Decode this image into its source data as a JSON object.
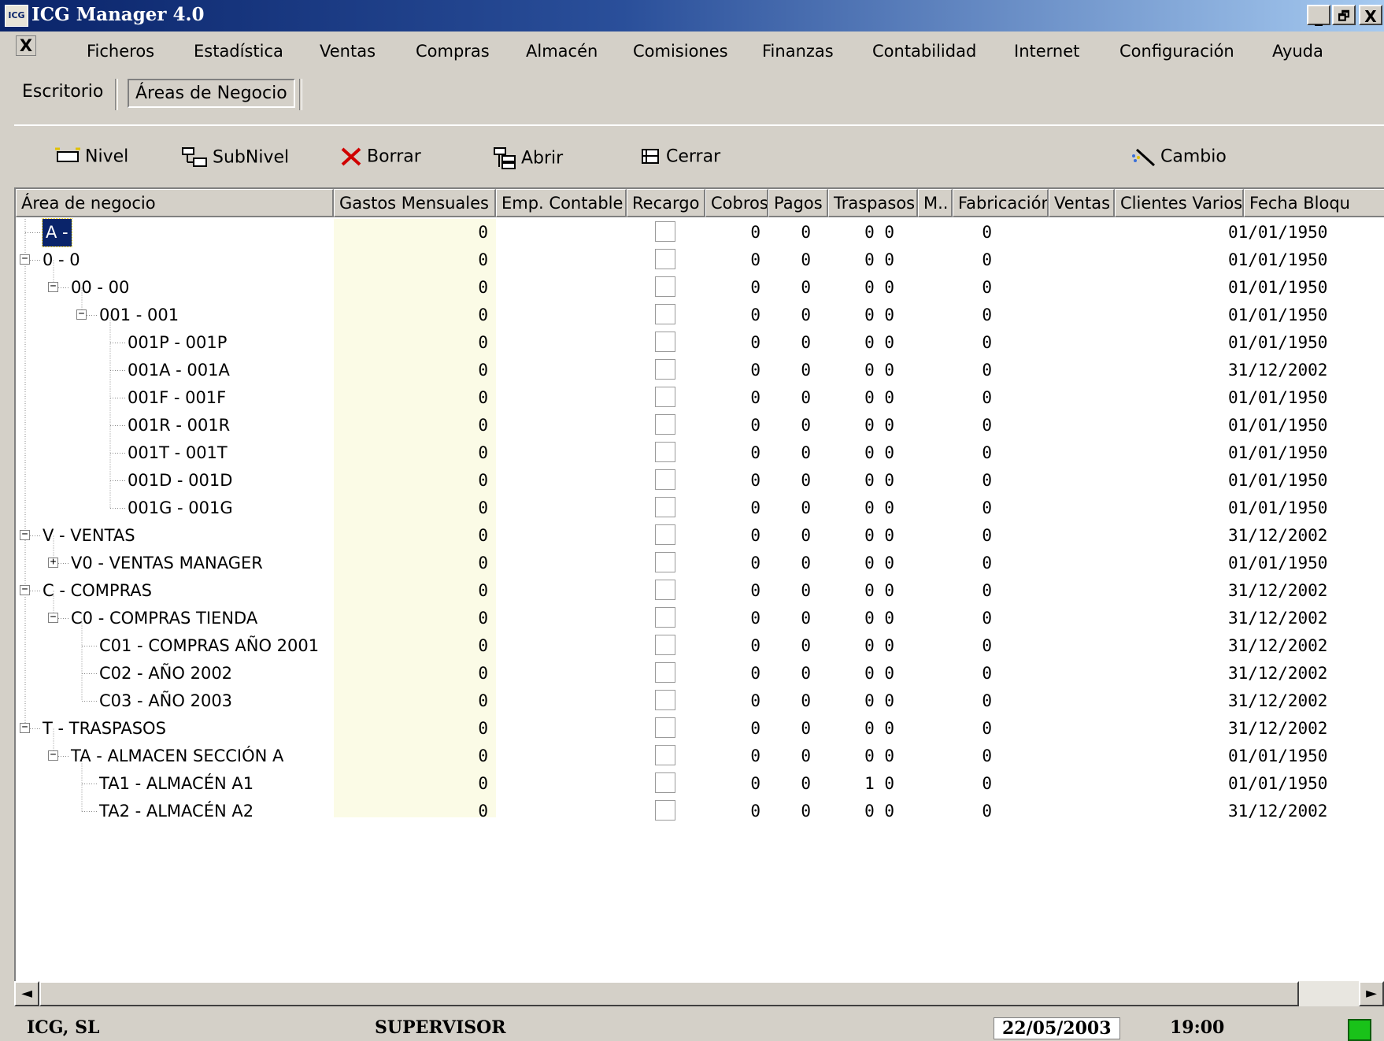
{
  "window": {
    "title": "ICG Manager 4.0",
    "icon_text": "ICG",
    "minimize": "_",
    "restore": "🗗",
    "close": "X"
  },
  "menu": {
    "close_doc": "X",
    "items": [
      "Ficheros",
      "Estadística",
      "Ventas",
      "Compras",
      "Almacén",
      "Comisiones",
      "Finanzas",
      "Contabilidad",
      "Internet",
      "Configuración",
      "Ayuda"
    ]
  },
  "tabs": [
    "Escritorio",
    "Áreas de Negocio"
  ],
  "toolbar": {
    "nivel": "Nivel",
    "subnivel": "SubNivel",
    "borrar": "Borrar",
    "abrir": "Abrir",
    "cerrar": "Cerrar",
    "cambio": "Cambio"
  },
  "columns": [
    "Área de negocio",
    "Gastos Mensuales",
    "Emp. Contable",
    "Recargo",
    "Cobros",
    "Pagos",
    "Traspasos",
    "M..",
    "Fabricación",
    "Ventas",
    "Clientes Varios",
    "Fecha Bloqu"
  ],
  "rows": [
    {
      "name": "A -",
      "level": 0,
      "exp": "",
      "selected": true,
      "gastos": "0",
      "cobros": "0",
      "pagos": "0",
      "trasp": "0 0",
      "fab": "0",
      "fecha": "01/01/1950"
    },
    {
      "name": "0 - 0",
      "level": 0,
      "exp": "-",
      "gastos": "0",
      "cobros": "0",
      "pagos": "0",
      "trasp": "0 0",
      "fab": "0",
      "fecha": "01/01/1950"
    },
    {
      "name": "00 - 00",
      "level": 1,
      "exp": "-",
      "gastos": "0",
      "cobros": "0",
      "pagos": "0",
      "trasp": "0 0",
      "fab": "0",
      "fecha": "01/01/1950"
    },
    {
      "name": "001 - 001",
      "level": 2,
      "exp": "-",
      "gastos": "0",
      "cobros": "0",
      "pagos": "0",
      "trasp": "0 0",
      "fab": "0",
      "fecha": "01/01/1950"
    },
    {
      "name": "001P - 001P",
      "level": 3,
      "exp": "",
      "gastos": "0",
      "cobros": "0",
      "pagos": "0",
      "trasp": "0 0",
      "fab": "0",
      "fecha": "01/01/1950"
    },
    {
      "name": "001A - 001A",
      "level": 3,
      "exp": "",
      "gastos": "0",
      "cobros": "0",
      "pagos": "0",
      "trasp": "0 0",
      "fab": "0",
      "fecha": "31/12/2002"
    },
    {
      "name": "001F - 001F",
      "level": 3,
      "exp": "",
      "gastos": "0",
      "cobros": "0",
      "pagos": "0",
      "trasp": "0 0",
      "fab": "0",
      "fecha": "01/01/1950"
    },
    {
      "name": "001R - 001R",
      "level": 3,
      "exp": "",
      "gastos": "0",
      "cobros": "0",
      "pagos": "0",
      "trasp": "0 0",
      "fab": "0",
      "fecha": "01/01/1950"
    },
    {
      "name": "001T - 001T",
      "level": 3,
      "exp": "",
      "gastos": "0",
      "cobros": "0",
      "pagos": "0",
      "trasp": "0 0",
      "fab": "0",
      "fecha": "01/01/1950"
    },
    {
      "name": "001D - 001D",
      "level": 3,
      "exp": "",
      "gastos": "0",
      "cobros": "0",
      "pagos": "0",
      "trasp": "0 0",
      "fab": "0",
      "fecha": "01/01/1950"
    },
    {
      "name": "001G - 001G",
      "level": 3,
      "exp": "",
      "gastos": "0",
      "cobros": "0",
      "pagos": "0",
      "trasp": "0 0",
      "fab": "0",
      "fecha": "01/01/1950"
    },
    {
      "name": "V - VENTAS",
      "level": 0,
      "exp": "-",
      "gastos": "0",
      "cobros": "0",
      "pagos": "0",
      "trasp": "0 0",
      "fab": "0",
      "fecha": "31/12/2002"
    },
    {
      "name": "V0 - VENTAS MANAGER",
      "level": 1,
      "exp": "+",
      "gastos": "0",
      "cobros": "0",
      "pagos": "0",
      "trasp": "0 0",
      "fab": "0",
      "fecha": "01/01/1950"
    },
    {
      "name": "C - COMPRAS",
      "level": 0,
      "exp": "-",
      "gastos": "0",
      "cobros": "0",
      "pagos": "0",
      "trasp": "0 0",
      "fab": "0",
      "fecha": "31/12/2002"
    },
    {
      "name": "C0 - COMPRAS TIENDA",
      "level": 1,
      "exp": "-",
      "gastos": "0",
      "cobros": "0",
      "pagos": "0",
      "trasp": "0 0",
      "fab": "0",
      "fecha": "31/12/2002"
    },
    {
      "name": "C01 - COMPRAS AÑO 2001",
      "level": 2,
      "exp": "",
      "gastos": "0",
      "cobros": "0",
      "pagos": "0",
      "trasp": "0 0",
      "fab": "0",
      "fecha": "31/12/2002"
    },
    {
      "name": "C02 - AÑO 2002",
      "level": 2,
      "exp": "",
      "gastos": "0",
      "cobros": "0",
      "pagos": "0",
      "trasp": "0 0",
      "fab": "0",
      "fecha": "31/12/2002"
    },
    {
      "name": "C03 - AÑO 2003",
      "level": 2,
      "exp": "",
      "gastos": "0",
      "cobros": "0",
      "pagos": "0",
      "trasp": "0 0",
      "fab": "0",
      "fecha": "31/12/2002"
    },
    {
      "name": "T - TRASPASOS",
      "level": 0,
      "exp": "-",
      "gastos": "0",
      "cobros": "0",
      "pagos": "0",
      "trasp": "0 0",
      "fab": "0",
      "fecha": "31/12/2002"
    },
    {
      "name": "TA - ALMACEN SECCIÓN A",
      "level": 1,
      "exp": "-",
      "gastos": "0",
      "cobros": "0",
      "pagos": "0",
      "trasp": "0 0",
      "fab": "0",
      "fecha": "01/01/1950"
    },
    {
      "name": "TA1 - ALMACÉN A1",
      "level": 2,
      "exp": "",
      "gastos": "0",
      "cobros": "0",
      "pagos": "0",
      "trasp": "1 0",
      "fab": "0",
      "fecha": "01/01/1950"
    },
    {
      "name": "TA2 - ALMACÉN A2",
      "level": 2,
      "exp": "",
      "gastos": "0",
      "cobros": "0",
      "pagos": "0",
      "trasp": "0 0",
      "fab": "0",
      "fecha": "31/12/2002"
    }
  ],
  "scroll": {
    "left": "◄",
    "right": "►"
  },
  "status": {
    "company": "ICG, SL",
    "user": "SUPERVISOR",
    "date": "22/05/2003",
    "time": "19:00",
    "indicator_color": "#19c219"
  }
}
